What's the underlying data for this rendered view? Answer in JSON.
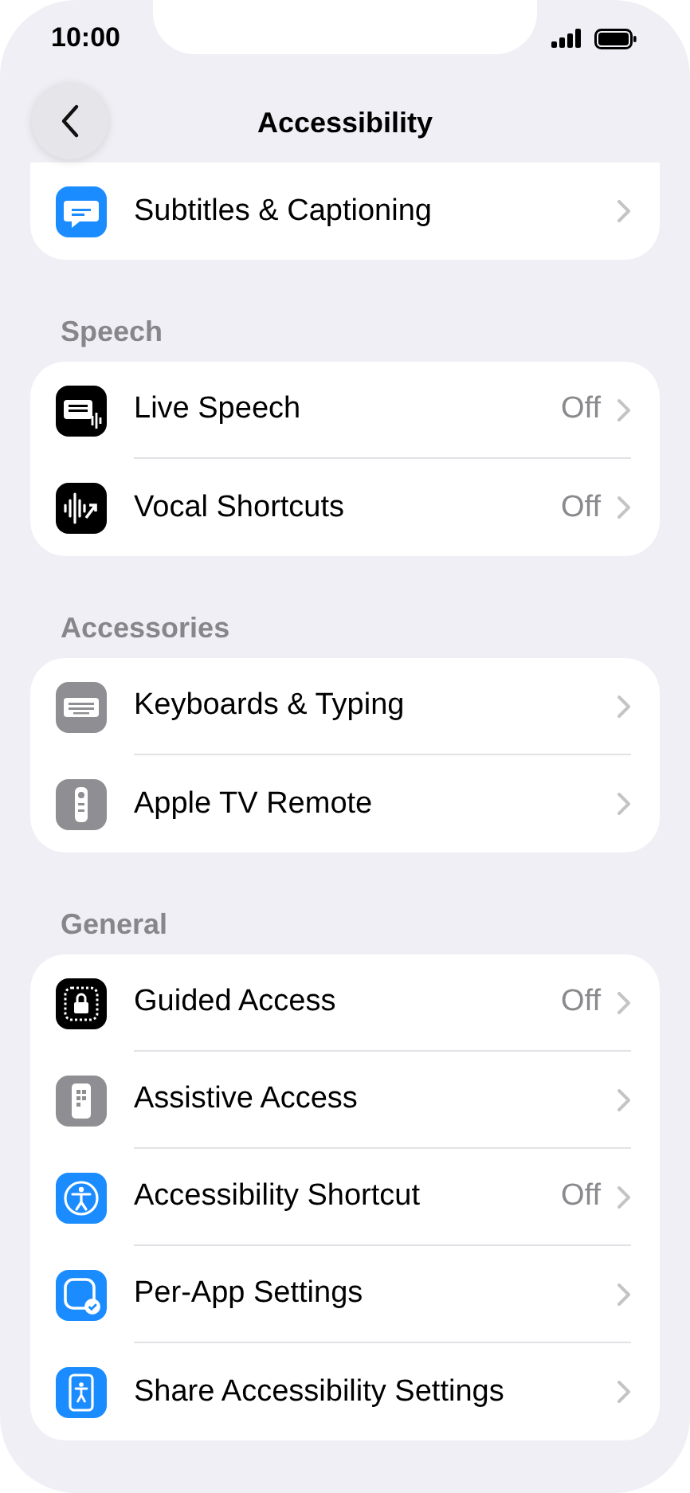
{
  "status_bar": {
    "time": "10:00"
  },
  "nav": {
    "title": "Accessibility"
  },
  "sections": [
    {
      "items": [
        {
          "kind": "subtitles",
          "label": "Subtitles & Captioning"
        }
      ]
    },
    {
      "header": "Speech",
      "items": [
        {
          "kind": "live-speech",
          "label": "Live Speech",
          "value": "Off"
        },
        {
          "kind": "vocal-shortcuts",
          "label": "Vocal Shortcuts",
          "value": "Off"
        }
      ]
    },
    {
      "header": "Accessories",
      "items": [
        {
          "kind": "keyboard",
          "label": "Keyboards & Typing"
        },
        {
          "kind": "remote",
          "label": "Apple TV Remote"
        }
      ]
    },
    {
      "header": "General",
      "items": [
        {
          "kind": "guided-access",
          "label": "Guided Access",
          "value": "Off"
        },
        {
          "kind": "assistive-access",
          "label": "Assistive Access"
        },
        {
          "kind": "accessibility",
          "label": "Accessibility Shortcut",
          "value": "Off"
        },
        {
          "kind": "per-app",
          "label": "Per-App Settings"
        },
        {
          "kind": "share-accessibility",
          "label": "Share Accessibility Settings"
        }
      ]
    }
  ]
}
